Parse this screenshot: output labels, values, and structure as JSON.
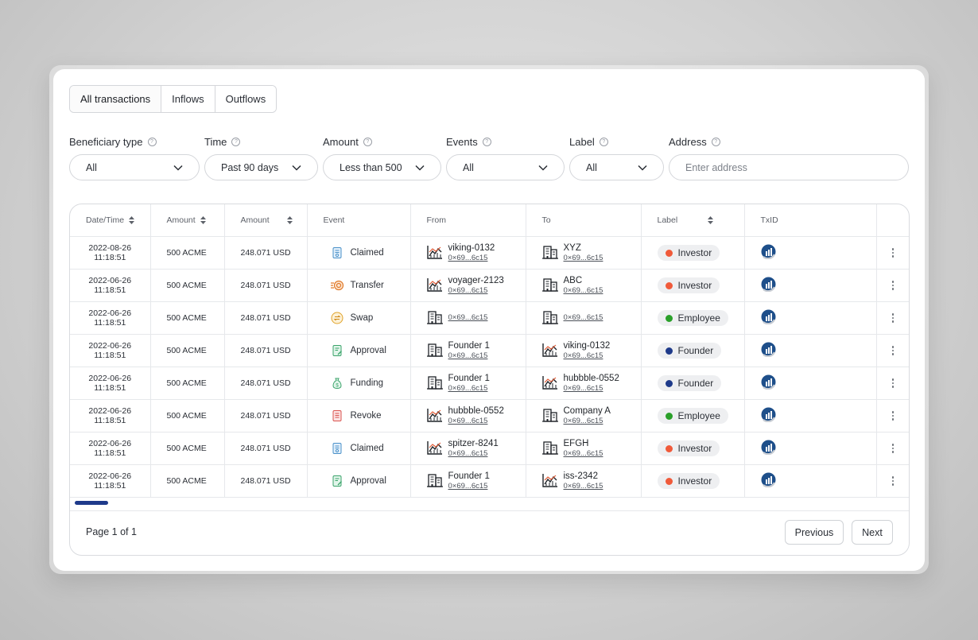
{
  "tabs": [
    "All transactions",
    "Inflows",
    "Outflows"
  ],
  "filters": {
    "beneficiary": {
      "label": "Beneficiary type",
      "value": "All"
    },
    "time": {
      "label": "Time",
      "value": "Past 90 days"
    },
    "amount": {
      "label": "Amount",
      "value": "Less than 500"
    },
    "events": {
      "label": "Events",
      "value": "All"
    },
    "label": {
      "label": "Label",
      "value": "All"
    },
    "address": {
      "label": "Address",
      "placeholder": "Enter address"
    }
  },
  "columns": [
    "Date/Time",
    "Amount",
    "Amount",
    "Event",
    "From",
    "To",
    "Label",
    "TxID"
  ],
  "rows": [
    {
      "date": "2022-08-26",
      "time": "11:18:51",
      "amount": "500 ACME",
      "usd": "248.071 USD",
      "event": "Claimed",
      "event_icon": "document-icon",
      "from_name": "viking-0132",
      "from_addr": "0×69...6c15",
      "from_icon": "chart-icon",
      "to_name": "XYZ",
      "to_addr": "0×69...6c15",
      "to_icon": "building-icon",
      "label": "Investor",
      "label_color": "#f05a3a"
    },
    {
      "date": "2022-06-26",
      "time": "11:18:51",
      "amount": "500 ACME",
      "usd": "248.071 USD",
      "event": "Transfer",
      "event_icon": "transfer-icon",
      "from_name": "voyager-2123",
      "from_addr": "0×69...6c15",
      "from_icon": "chart-icon",
      "to_name": "ABC",
      "to_addr": "0×69...6c15",
      "to_icon": "building-icon",
      "label": "Investor",
      "label_color": "#f05a3a"
    },
    {
      "date": "2022-06-26",
      "time": "11:18:51",
      "amount": "500 ACME",
      "usd": "248.071 USD",
      "event": "Swap",
      "event_icon": "swap-icon",
      "from_name": "",
      "from_addr": "0×69...6c15",
      "from_icon": "building-icon",
      "to_name": "",
      "to_addr": "0×69...6c15",
      "to_icon": "building-icon",
      "label": "Employee",
      "label_color": "#2aa02a"
    },
    {
      "date": "2022-06-26",
      "time": "11:18:51",
      "amount": "500 ACME",
      "usd": "248.071 USD",
      "event": "Approval",
      "event_icon": "approval-icon",
      "from_name": "Founder 1",
      "from_addr": "0×69...6c15",
      "from_icon": "building-icon",
      "to_name": "viking-0132",
      "to_addr": "0×69...6c15",
      "to_icon": "chart-icon",
      "label": "Founder",
      "label_color": "#1e3a8a"
    },
    {
      "date": "2022-06-26",
      "time": "11:18:51",
      "amount": "500 ACME",
      "usd": "248.071 USD",
      "event": "Funding",
      "event_icon": "funding-icon",
      "from_name": "Founder 1",
      "from_addr": "0×69...6c15",
      "from_icon": "building-icon",
      "to_name": "hubbble-0552",
      "to_addr": "0×69...6c15",
      "to_icon": "chart-icon",
      "label": "Founder",
      "label_color": "#1e3a8a"
    },
    {
      "date": "2022-06-26",
      "time": "11:18:51",
      "amount": "500 ACME",
      "usd": "248.071 USD",
      "event": "Revoke",
      "event_icon": "revoke-icon",
      "from_name": "hubbble-0552",
      "from_addr": "0×69...6c15",
      "from_icon": "chart-icon",
      "to_name": "Company A",
      "to_addr": "0×69...6c15",
      "to_icon": "building-icon",
      "label": "Employee",
      "label_color": "#2aa02a"
    },
    {
      "date": "2022-06-26",
      "time": "11:18:51",
      "amount": "500 ACME",
      "usd": "248.071 USD",
      "event": "Claimed",
      "event_icon": "document-icon",
      "from_name": "spitzer-8241",
      "from_addr": "0×69...6c15",
      "from_icon": "chart-icon",
      "to_name": "EFGH",
      "to_addr": "0×69...6c15",
      "to_icon": "building-icon",
      "label": "Investor",
      "label_color": "#f05a3a"
    },
    {
      "date": "2022-06-26",
      "time": "11:18:51",
      "amount": "500 ACME",
      "usd": "248.071 USD",
      "event": "Approval",
      "event_icon": "approval-icon",
      "from_name": "Founder 1",
      "from_addr": "0×69...6c15",
      "from_icon": "building-icon",
      "to_name": "iss-2342",
      "to_addr": "0×69...6c15",
      "to_icon": "chart-icon",
      "label": "Investor",
      "label_color": "#f05a3a"
    }
  ],
  "pagination": {
    "info": "Page 1 of 1",
    "previous": "Previous",
    "next": "Next"
  }
}
